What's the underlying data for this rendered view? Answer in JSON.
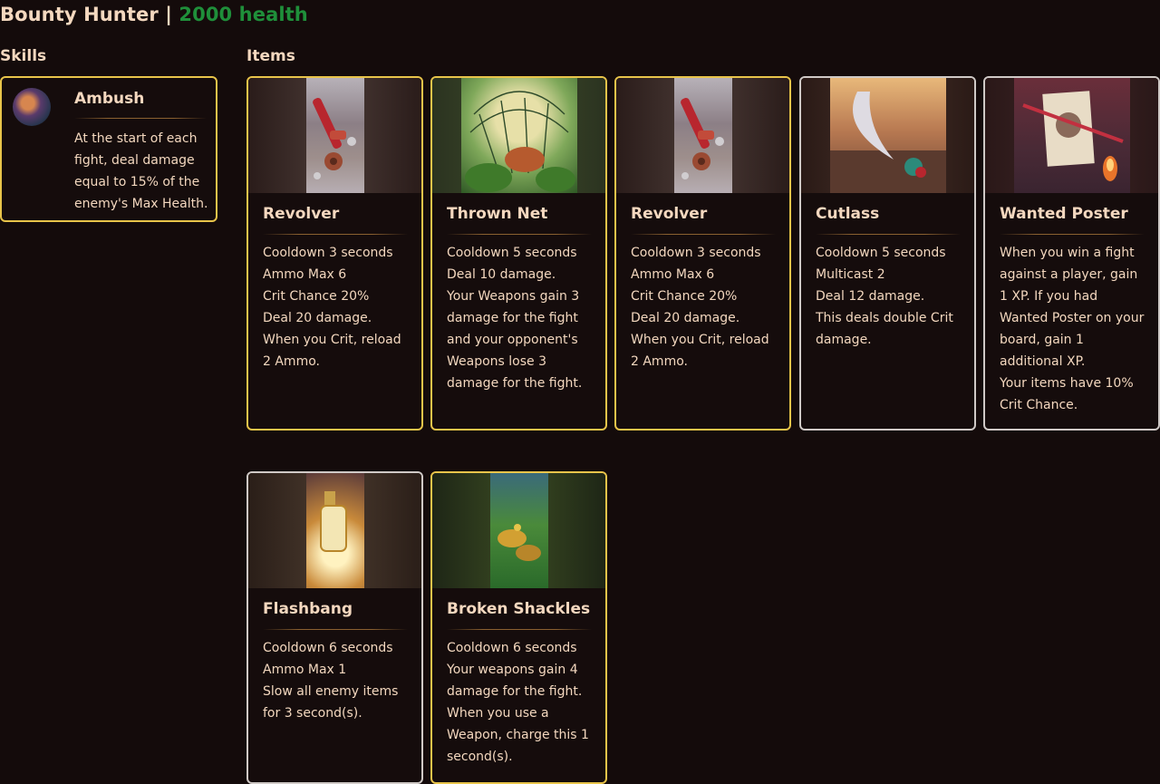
{
  "header": {
    "name": "Bounty Hunter",
    "separator": "|",
    "health": "2000 health",
    "health_color": "#1f8f3a"
  },
  "sections": {
    "skills_label": "Skills",
    "items_label": "Items"
  },
  "skill": {
    "title": "Ambush",
    "icon": "ambush-portrait-icon",
    "text": "At the start of each fight, deal damage equal to 15% of the enemy's Max Health."
  },
  "items": [
    {
      "title": "Revolver",
      "border": "gold",
      "art": "revolver-art",
      "lines": [
        "Cooldown 3 seconds",
        "Ammo Max 6",
        "Crit Chance 20%",
        "Deal 20 damage.",
        "When you Crit, reload 2 Ammo."
      ]
    },
    {
      "title": "Thrown Net",
      "border": "gold",
      "art": "thrown-net-art",
      "lines": [
        "Cooldown 5 seconds",
        "Deal 10 damage.",
        "Your Weapons gain 3 damage for the fight and your opponent's Weapons lose 3 damage for the fight."
      ]
    },
    {
      "title": "Revolver",
      "border": "gold",
      "art": "revolver-art",
      "lines": [
        "Cooldown 3 seconds",
        "Ammo Max 6",
        "Crit Chance 20%",
        "Deal 20 damage.",
        "When you Crit, reload 2 Ammo."
      ]
    },
    {
      "title": "Cutlass",
      "border": "silver",
      "art": "cutlass-art",
      "lines": [
        "Cooldown 5 seconds",
        "Multicast 2",
        "Deal 12 damage.",
        "This deals double Crit damage."
      ]
    },
    {
      "title": "Wanted Poster",
      "border": "silver",
      "art": "wanted-poster-art",
      "lines": [
        "When you win a fight against a player, gain 1 XP. If you had Wanted Poster on your board, gain 1 additional XP.",
        "Your items have 10% Crit Chance."
      ]
    },
    {
      "title": "Flashbang",
      "border": "silver",
      "art": "flashbang-art",
      "lines": [
        "Cooldown 6 seconds",
        "Ammo Max 1",
        "Slow all enemy items for 3 second(s)."
      ]
    },
    {
      "title": "Broken Shackles",
      "border": "gold",
      "art": "broken-shackles-art",
      "lines": [
        "Cooldown 6 seconds",
        "Your weapons gain 4 damage for the fight.",
        "When you use a Weapon, charge this 1 second(s)."
      ]
    }
  ]
}
